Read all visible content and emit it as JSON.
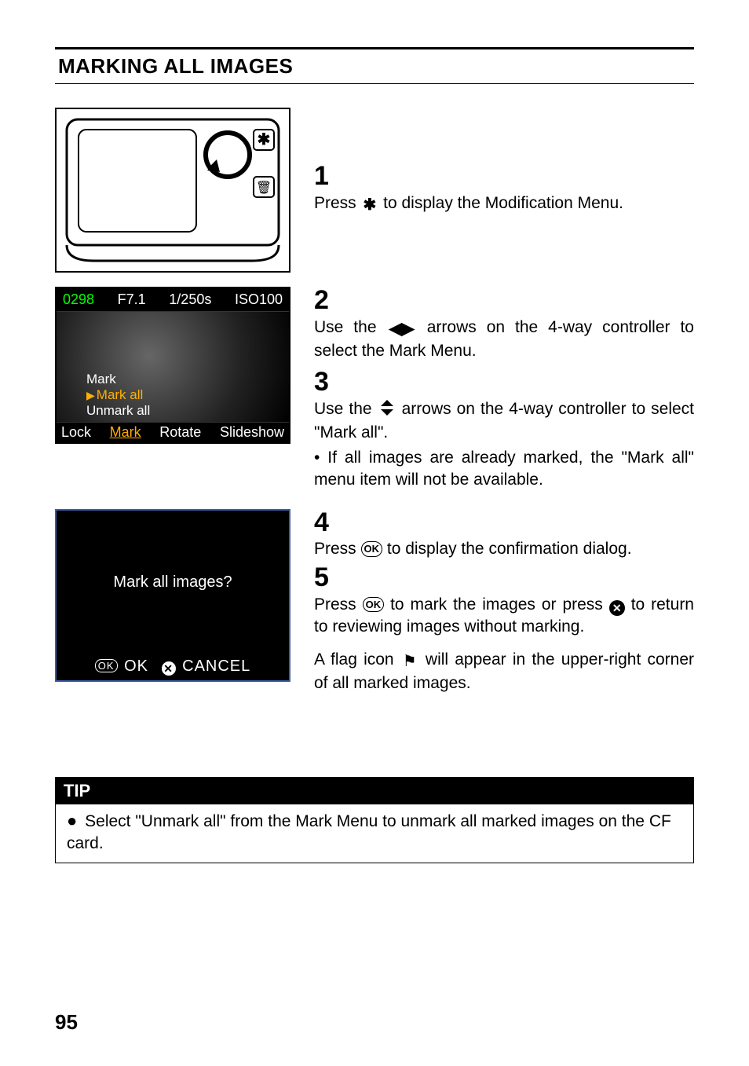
{
  "title": "MARKING ALL IMAGES",
  "step1": {
    "num": "1",
    "text_pre": "Press ",
    "icon": "✱",
    "text_post": " to display the Modification Menu."
  },
  "lcd": {
    "count": "0298",
    "f": "F7.1",
    "shutter": "1/250s",
    "iso": "ISO100",
    "menu_head": "Mark",
    "menu_sel": "Mark all",
    "menu_item": "Unmark all",
    "b_lock": "Lock",
    "b_mark": "Mark",
    "b_rotate": "Rotate",
    "b_slide": "Slideshow"
  },
  "step2": {
    "num": "2",
    "pre": "Use the ",
    "icon_lr": "◀▶",
    "post": " arrows on the 4-way controller to select the Mark Menu."
  },
  "step3": {
    "num": "3",
    "line1_pre": "Use the ",
    "icon_ud": "⇵",
    "line1_post": " arrows on the 4-way controller to select \"Mark all\".",
    "bullet_dot": "•",
    "line2": "If all images are already marked, the \"Mark all\" menu item will not be available."
  },
  "dialog": {
    "q": "Mark all images?",
    "ok_badge": "OK",
    "ok": "OK",
    "x": "✕",
    "cancel": "CANCEL"
  },
  "step4": {
    "num": "4",
    "pre": "Press ",
    "ok": "OK",
    "post": " to display the confirmation dialog."
  },
  "step5": {
    "num": "5",
    "pre": "Press ",
    "ok": "OK",
    "mid": " to mark the images or press ",
    "x": "✕",
    "post": " to return to reviewing images without marking.",
    "note_pre": "A flag icon ",
    "flag": "⚑",
    "note_post": " will appear in the upper-right corner of all marked images."
  },
  "tip": {
    "hdr": "TIP",
    "bullet": "●",
    "body": " Select \"Unmark all\" from the Mark Menu to unmark all marked images on the CF card."
  },
  "page_num": "95"
}
